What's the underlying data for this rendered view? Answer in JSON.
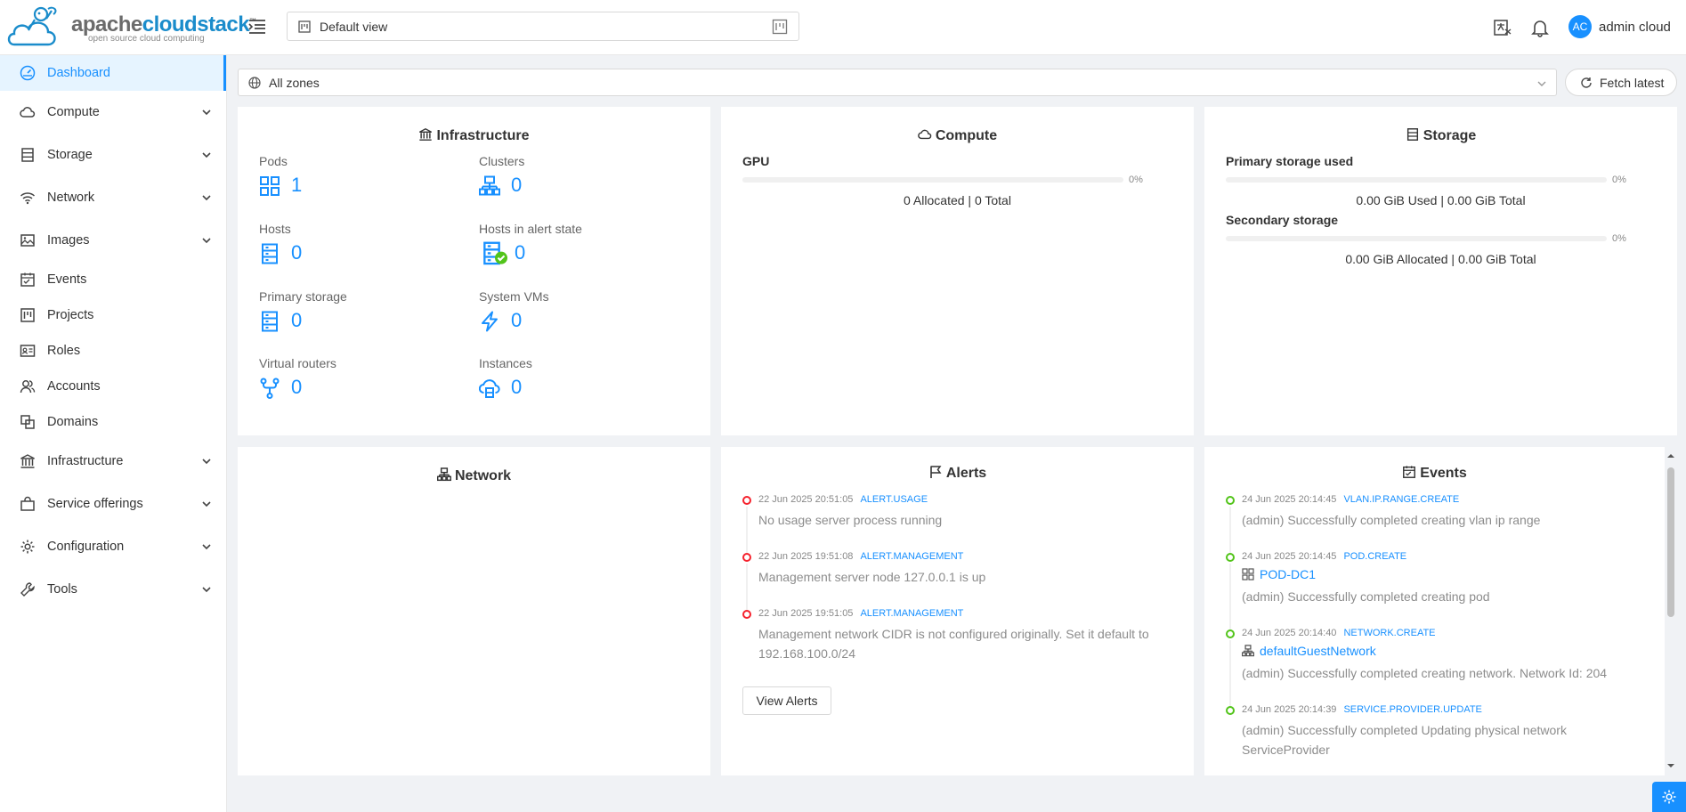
{
  "brand": {
    "word_a": "apache",
    "word_b": "cloudstack",
    "tagline": "open source cloud computing"
  },
  "header": {
    "view_select": "Default view",
    "user": {
      "initials": "AC",
      "name": "admin cloud"
    }
  },
  "sidebar": {
    "items": [
      {
        "label": "Dashboard",
        "icon": "dashboard-icon",
        "active": true
      },
      {
        "label": "Compute",
        "icon": "cloud-icon",
        "expandable": true
      },
      {
        "label": "Storage",
        "icon": "database-icon",
        "expandable": true
      },
      {
        "label": "Network",
        "icon": "wifi-icon",
        "expandable": true
      },
      {
        "label": "Images",
        "icon": "picture-icon",
        "expandable": true
      },
      {
        "label": "Events",
        "icon": "schedule-icon"
      },
      {
        "label": "Projects",
        "icon": "project-icon"
      },
      {
        "label": "Roles",
        "icon": "idcard-icon"
      },
      {
        "label": "Accounts",
        "icon": "team-icon"
      },
      {
        "label": "Domains",
        "icon": "block-icon"
      },
      {
        "label": "Infrastructure",
        "icon": "bank-icon",
        "expandable": true
      },
      {
        "label": "Service offerings",
        "icon": "shopping-icon",
        "expandable": true
      },
      {
        "label": "Configuration",
        "icon": "setting-icon",
        "expandable": true
      },
      {
        "label": "Tools",
        "icon": "tool-icon",
        "expandable": true
      }
    ]
  },
  "zone": {
    "value": "All zones",
    "fetch_label": "Fetch latest"
  },
  "infrastructure": {
    "title": "Infrastructure",
    "stats": [
      {
        "label": "Pods",
        "value": "1",
        "icon": "appstore-icon"
      },
      {
        "label": "Clusters",
        "value": "0",
        "icon": "cluster-icon"
      },
      {
        "label": "Hosts",
        "value": "0",
        "icon": "database-icon"
      },
      {
        "label": "Hosts in alert state",
        "value": "0",
        "icon": "host-alert-icon"
      },
      {
        "label": "Primary storage",
        "value": "0",
        "icon": "database-icon"
      },
      {
        "label": "System VMs",
        "value": "0",
        "icon": "thunderbolt-icon"
      },
      {
        "label": "Virtual routers",
        "value": "0",
        "icon": "fork-icon"
      },
      {
        "label": "Instances",
        "value": "0",
        "icon": "cloud-server-icon"
      }
    ]
  },
  "compute": {
    "title": "Compute",
    "gpu": {
      "label": "GPU",
      "percent": 0,
      "percent_text": "0%",
      "caption": "0 Allocated | 0 Total"
    }
  },
  "storage": {
    "title": "Storage",
    "primary": {
      "label": "Primary storage used",
      "percent": 0,
      "percent_text": "0%",
      "caption": "0.00 GiB Used | 0.00 GiB Total"
    },
    "secondary": {
      "label": "Secondary storage",
      "percent": 0,
      "percent_text": "0%",
      "caption": "0.00 GiB Allocated | 0.00 GiB Total"
    }
  },
  "network": {
    "title": "Network"
  },
  "alerts": {
    "title": "Alerts",
    "view_all_label": "View Alerts",
    "items": [
      {
        "time": "22 Jun 2025 20:51:05",
        "type": "ALERT.USAGE",
        "description": "No usage server process running"
      },
      {
        "time": "22 Jun 2025 19:51:08",
        "type": "ALERT.MANAGEMENT",
        "description": "Management server node 127.0.0.1 is up"
      },
      {
        "time": "22 Jun 2025 19:51:05",
        "type": "ALERT.MANAGEMENT",
        "description": "Management network CIDR is not configured originally. Set it default to 192.168.100.0/24"
      }
    ]
  },
  "events": {
    "title": "Events",
    "items": [
      {
        "time": "24 Jun 2025 20:14:45",
        "type": "VLAN.IP.RANGE.CREATE",
        "description": "(admin) Successfully completed creating vlan ip range"
      },
      {
        "time": "24 Jun 2025 20:14:45",
        "type": "POD.CREATE",
        "link": "POD-DC1",
        "link_icon": "appstore-icon",
        "description": "(admin) Successfully completed creating pod"
      },
      {
        "time": "24 Jun 2025 20:14:40",
        "type": "NETWORK.CREATE",
        "link": "defaultGuestNetwork",
        "link_icon": "cluster-icon",
        "description": "(admin) Successfully completed creating network. Network Id: 204"
      },
      {
        "time": "24 Jun 2025 20:14:39",
        "type": "SERVICE.PROVIDER.UPDATE",
        "description": "(admin) Successfully completed Updating physical network ServiceProvider"
      }
    ]
  },
  "colors": {
    "accent": "#1890ff",
    "alert_dot": "#f5222d",
    "event_dot": "#52c41a",
    "ok_badge": "#52c41a"
  }
}
